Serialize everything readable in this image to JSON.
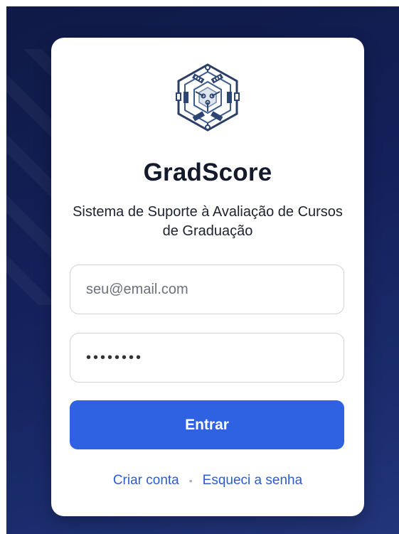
{
  "app": {
    "title": "GradScore",
    "subtitle": "Sistema de Suporte à Avaliação de Cursos de Graduação"
  },
  "form": {
    "email_placeholder": "seu@email.com",
    "email_value": "",
    "password_value": "password",
    "submit_label": "Entrar"
  },
  "links": {
    "create_account": "Criar conta",
    "separator": "•",
    "forgot_password": "Esqueci a senha"
  },
  "colors": {
    "accent": "#2f62e2",
    "link": "#2a5bd7",
    "background": "#14205a",
    "title": "#141a2c"
  },
  "icons": {
    "logo": "circuit-hexagon-logo-icon"
  }
}
